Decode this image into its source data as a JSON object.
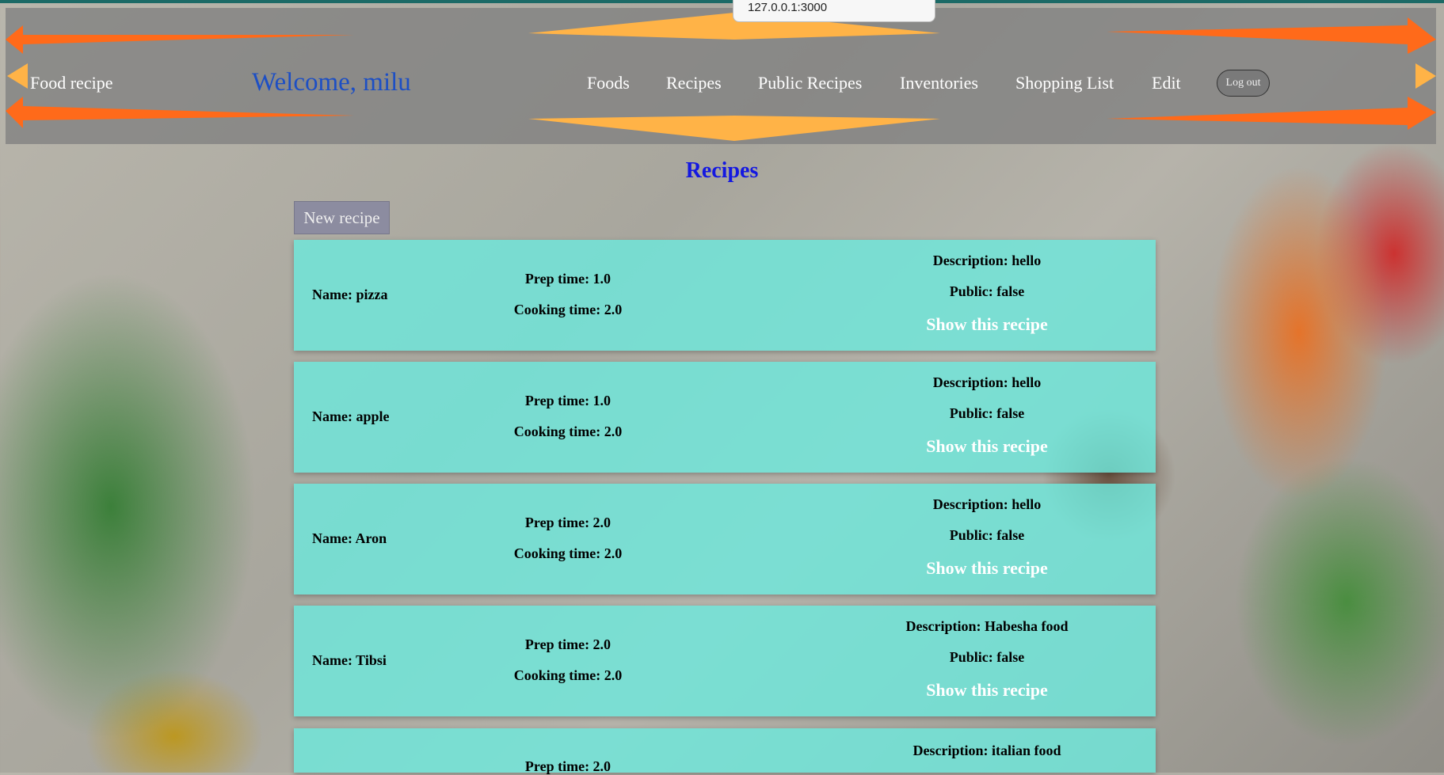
{
  "browser": {
    "url": "127.0.0.1:3000"
  },
  "nav": {
    "brand": "Food recipe",
    "welcome": "Welcome, milu",
    "links": [
      "Foods",
      "Recipes",
      "Public Recipes",
      "Inventories",
      "Shopping List",
      "Edit"
    ],
    "logout_label": "Log out"
  },
  "page": {
    "title": "Recipes",
    "new_recipe_label": "New recipe"
  },
  "recipes": [
    {
      "name": "Name: pizza",
      "prep": "Prep time: 1.0",
      "cook": "Cooking time: 2.0",
      "desc": "Description: hello",
      "public": "Public: false",
      "show": "Show this recipe"
    },
    {
      "name": "Name: apple",
      "prep": "Prep time: 1.0",
      "cook": "Cooking time: 2.0",
      "desc": "Description: hello",
      "public": "Public: false",
      "show": "Show this recipe"
    },
    {
      "name": "Name: Aron",
      "prep": "Prep time: 2.0",
      "cook": "Cooking time: 2.0",
      "desc": "Description: hello",
      "public": "Public: false",
      "show": "Show this recipe"
    },
    {
      "name": "Name: Tibsi",
      "prep": "Prep time: 2.0",
      "cook": "Cooking time: 2.0",
      "desc": "Description: Habesha food",
      "public": "Public: false",
      "show": "Show this recipe"
    },
    {
      "name": "",
      "prep": "Prep time: 2.0",
      "cook": "",
      "desc": "Description: italian food",
      "public": "",
      "show": ""
    }
  ],
  "colors": {
    "navbar": "#808080",
    "welcome": "#1d4fc4",
    "title": "#1418e0",
    "card": "#6ee8dc",
    "arrow_orange": "#ff6a1a",
    "arrow_yellow": "#ffb347"
  }
}
